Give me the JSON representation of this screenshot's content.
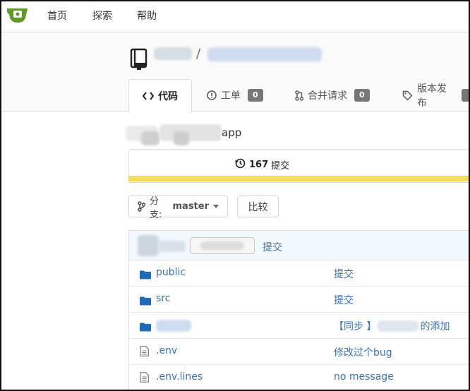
{
  "nav": {
    "items": [
      {
        "label": "首页"
      },
      {
        "label": "探索"
      },
      {
        "label": "帮助"
      }
    ]
  },
  "tabs": [
    {
      "label": "代码",
      "icon": "code-icon"
    },
    {
      "label": "工单",
      "icon": "issue-icon",
      "count": "0"
    },
    {
      "label": "合并请求",
      "icon": "pull-request-icon",
      "count": "0"
    },
    {
      "label": "版本发布",
      "icon": "tag-icon"
    }
  ],
  "repo": {
    "description_visible": "app",
    "commit_count": "167",
    "commit_label": "提交"
  },
  "toolbar": {
    "branch_prefix": "分支:",
    "branch_name": "master",
    "compare_label": "比较"
  },
  "latest_commit": {
    "link_label": "提交"
  },
  "files": [
    {
      "name": "public",
      "type": "folder",
      "message": "提交"
    },
    {
      "name": "src",
      "type": "folder",
      "message": "提交"
    },
    {
      "name": "",
      "type": "folder",
      "message_prefix": "【同步 】",
      "message_suffix": "的添加"
    },
    {
      "name": ".env",
      "type": "file",
      "message": "修改过个bug"
    },
    {
      "name": ".env.lines",
      "type": "file",
      "message": "no message"
    }
  ],
  "colors": {
    "link": "#3972b8",
    "folder": "#1e6bb8",
    "progress": "#f2dd5a",
    "badge": "#777777",
    "logo": "#609926"
  }
}
